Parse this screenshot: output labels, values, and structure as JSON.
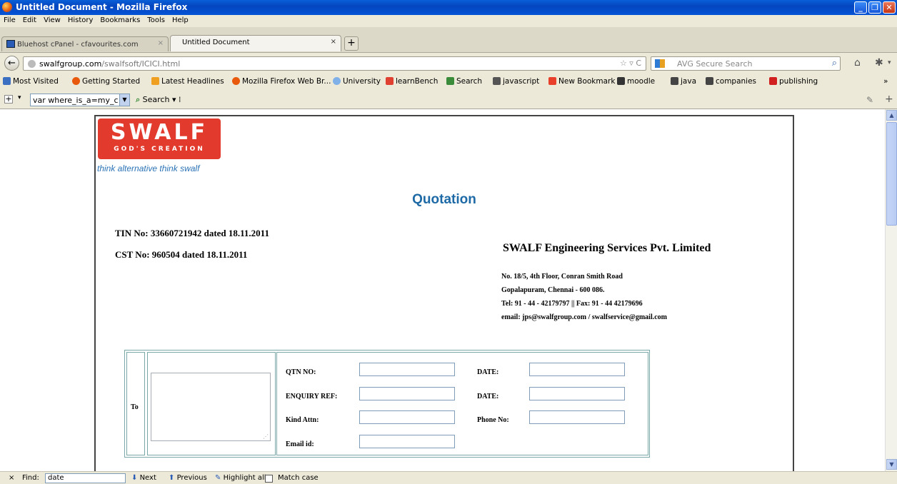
{
  "window": {
    "title": "Untitled Document - Mozilla Firefox"
  },
  "menu": [
    "File",
    "Edit",
    "View",
    "History",
    "Bookmarks",
    "Tools",
    "Help"
  ],
  "tabs": [
    {
      "label": "Bluehost cPanel - cfavourites.com"
    },
    {
      "label": "Untitled Document"
    }
  ],
  "nav": {
    "url_host": "swalfgroup.com",
    "url_path": "/swalfsoft/ICICI.html",
    "search_placeholder": "AVG Secure Search"
  },
  "bookmarks": [
    {
      "label": "Most Visited",
      "color": "#3b6fc1"
    },
    {
      "label": "Getting Started",
      "color": "#e8590c"
    },
    {
      "label": "Latest Headlines",
      "color": "#f0a020"
    },
    {
      "label": "Mozilla Firefox Web Br...",
      "color": "#e8590c"
    },
    {
      "label": "University",
      "color": "#7fb0e8"
    },
    {
      "label": "learnBench",
      "color": "#e04030"
    },
    {
      "label": "Search",
      "color": "#3a8c3a"
    },
    {
      "label": "javascript",
      "color": "#555555"
    },
    {
      "label": "New Bookmark",
      "color": "#e8402a"
    },
    {
      "label": "moodle",
      "color": "#333333"
    },
    {
      "label": "java",
      "color": "#444444"
    },
    {
      "label": "companies",
      "color": "#444444"
    },
    {
      "label": "publishing",
      "color": "#d02020"
    }
  ],
  "toolbar": {
    "input_value": "var where_is_a=my_c",
    "search_label": "Search"
  },
  "doc": {
    "logo_main": "SWALF",
    "logo_sub": "GOD'S CREATION",
    "tagline": "think alternative  think swalf",
    "title": "Quotation",
    "tin": "TIN No: 33660721942 dated 18.11.2011",
    "cst": "CST No: 960504 dated 18.11.2011",
    "company": "SWALF Engineering Services Pvt. Limited",
    "address1": "No. 18/5, 4th Floor, Conran Smith Road",
    "address2": "Gopalapuram, Chennai - 600 086.",
    "address3": "Tel: 91 - 44 - 42179797 || Fax: 91 - 44 42179696",
    "address4": "email: jps@swalfgroup.com / swalfservice@gmail.com",
    "to_label": "To",
    "labels": {
      "qtn_no": "QTN NO:",
      "enquiry_ref": "ENQUIRY REF:",
      "kind_attn": "Kind Attn:",
      "email_id": "Email id:",
      "date1": "DATE:",
      "date2": "DATE:",
      "phone_no": "Phone No:"
    }
  },
  "findbar": {
    "find_label": "Find:",
    "find_value": "date",
    "next": "Next",
    "previous": "Previous",
    "highlight": "Highlight all",
    "match_case": "Match case"
  }
}
